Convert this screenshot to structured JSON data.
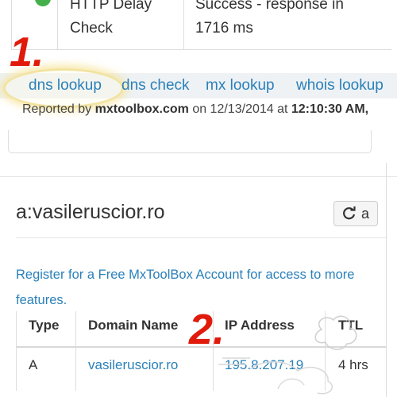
{
  "top_result": {
    "test_name_line1": "HTTP Delay",
    "test_name_line2": "Check",
    "result_line1": "Success - response in",
    "result_line2": "1716 ms",
    "status_color": "#45b04b"
  },
  "annotations": {
    "step1": "1.",
    "step2": "2.",
    "color": "#e01b0b"
  },
  "links": [
    {
      "label": "dns lookup"
    },
    {
      "label": "dns check"
    },
    {
      "label": "mx lookup"
    },
    {
      "label": "whois lookup"
    }
  ],
  "report": {
    "prefix": "Reported by",
    "site": "mxtoolbox.com",
    "on": "on 12/13/2014 at",
    "time": "12:10:30 AM,"
  },
  "panel": {
    "title": "a:vasileruscior.ro",
    "refresh_label": "a",
    "refresh_icon": "refresh-icon",
    "register_text": "Register for a Free MxToolBox Account for access to more features."
  },
  "table": {
    "headers": [
      "Type",
      "Domain Name",
      "IP Address",
      "TTL"
    ],
    "rows": [
      {
        "type": "A",
        "domain": "vasileruscior.ro",
        "ip": "195.8.207.19",
        "ttl": "4 hrs"
      }
    ]
  },
  "colors": {
    "link": "#2a80b9",
    "links_bar_bg": "#eef2f4"
  }
}
